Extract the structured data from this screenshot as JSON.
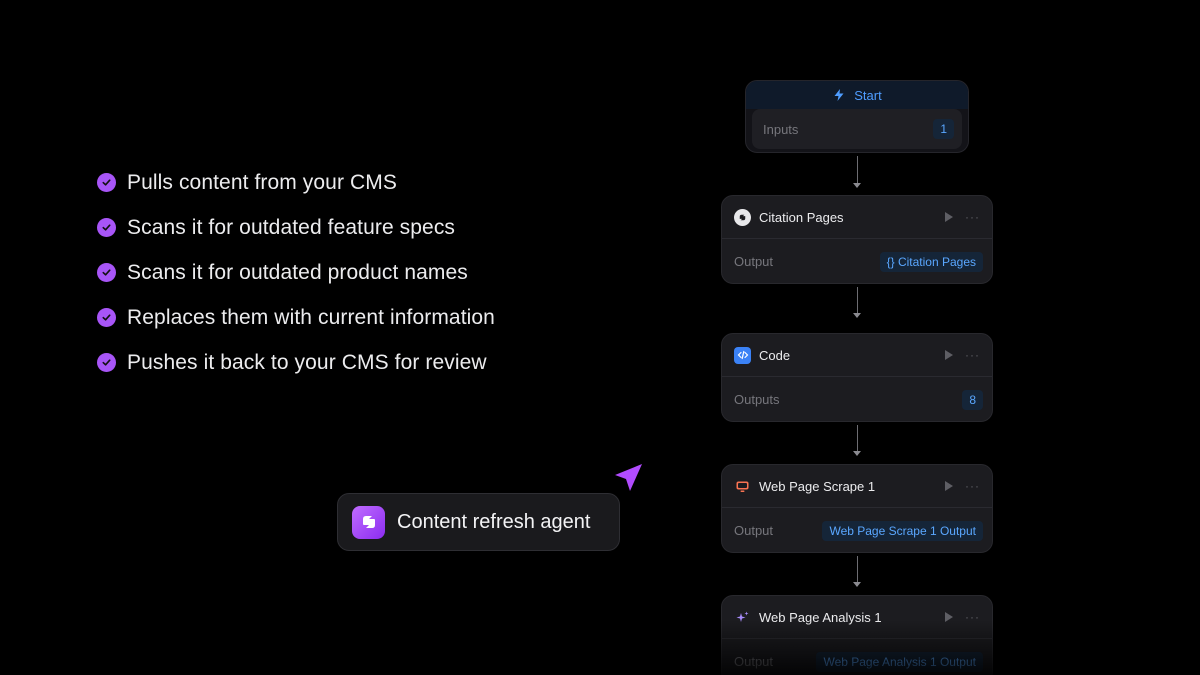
{
  "features": [
    {
      "text": "Pulls content from your CMS"
    },
    {
      "text": "Scans it for outdated feature specs"
    },
    {
      "text": "Scans it for outdated product names"
    },
    {
      "text": "Replaces them with current information"
    },
    {
      "text": "Pushes it back to your CMS for review"
    }
  ],
  "agent": {
    "label": "Content refresh agent"
  },
  "workflow": {
    "start": {
      "title": "Start",
      "field_label": "Inputs",
      "field_value": "1"
    },
    "nodes": [
      {
        "title": "Citation Pages",
        "field_label": "Output",
        "field_value": "{} Citation Pages",
        "icon": "citation-icon"
      },
      {
        "title": "Code",
        "field_label": "Outputs",
        "field_value": "8",
        "icon": "code-icon"
      },
      {
        "title": "Web Page Scrape 1",
        "field_label": "Output",
        "field_value": "Web Page Scrape 1 Output",
        "icon": "browser-icon"
      },
      {
        "title": "Web Page Analysis 1",
        "field_label": "Output",
        "field_value": "Web Page Analysis 1 Output",
        "icon": "sparkle-icon"
      }
    ]
  },
  "colors": {
    "accent": "#a855f7",
    "link": "#5aa7ff",
    "background": "#000000"
  }
}
